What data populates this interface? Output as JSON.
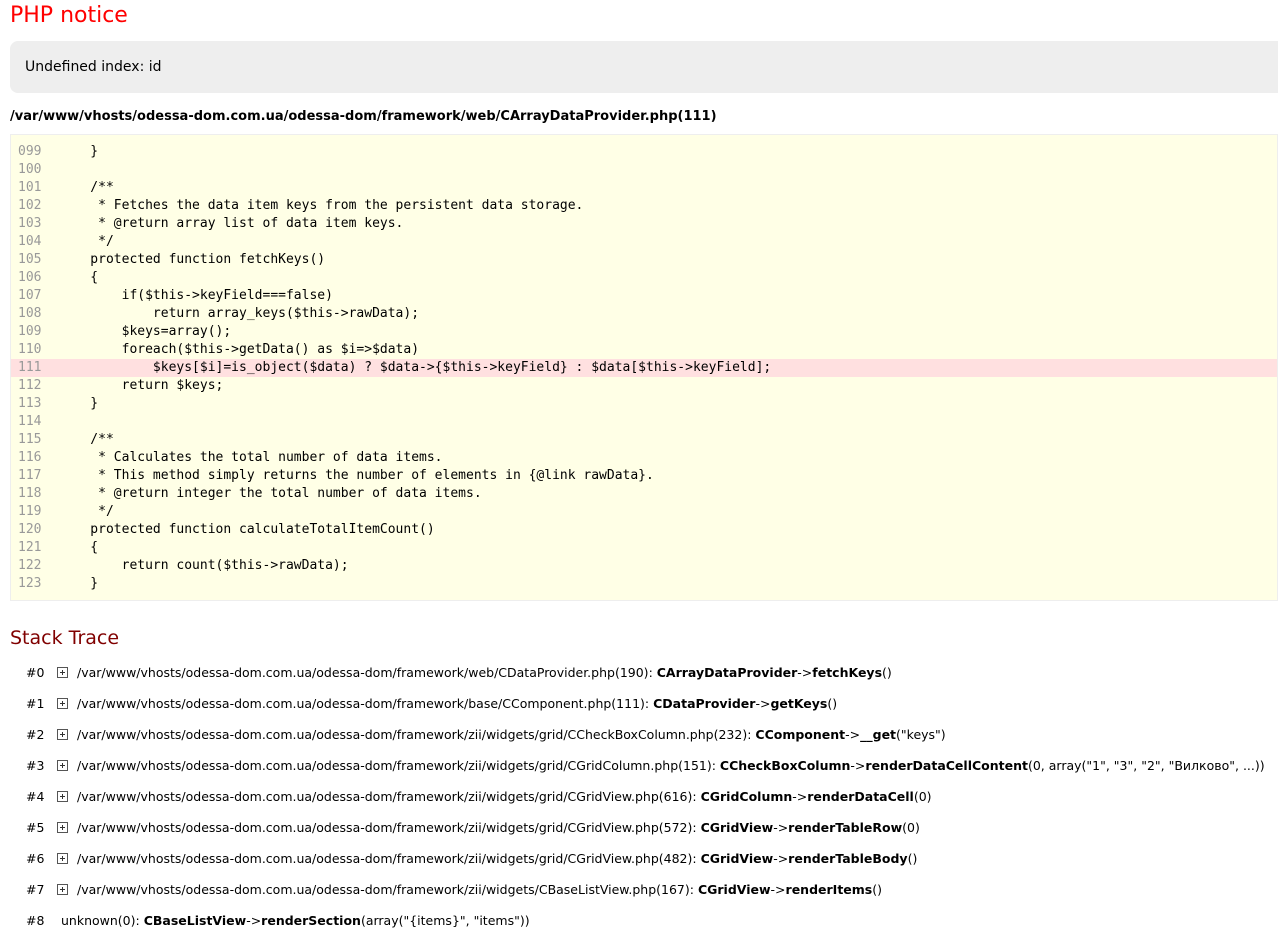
{
  "error": {
    "title": "PHP notice",
    "message": "Undefined index: id",
    "file": "/var/www/vhosts/odessa-dom.com.ua/odessa-dom/framework/web/CArrayDataProvider.php(111)"
  },
  "source": {
    "error_line": "111",
    "lines": [
      {
        "num": "099",
        "text": "    }"
      },
      {
        "num": "100",
        "text": ""
      },
      {
        "num": "101",
        "text": "    /**"
      },
      {
        "num": "102",
        "text": "     * Fetches the data item keys from the persistent data storage."
      },
      {
        "num": "103",
        "text": "     * @return array list of data item keys."
      },
      {
        "num": "104",
        "text": "     */"
      },
      {
        "num": "105",
        "text": "    protected function fetchKeys()"
      },
      {
        "num": "106",
        "text": "    {"
      },
      {
        "num": "107",
        "text": "        if($this->keyField===false)"
      },
      {
        "num": "108",
        "text": "            return array_keys($this->rawData);"
      },
      {
        "num": "109",
        "text": "        $keys=array();"
      },
      {
        "num": "110",
        "text": "        foreach($this->getData() as $i=>$data)"
      },
      {
        "num": "111",
        "text": "            $keys[$i]=is_object($data) ? $data->{$this->keyField} : $data[$this->keyField];"
      },
      {
        "num": "112",
        "text": "        return $keys;"
      },
      {
        "num": "113",
        "text": "    }"
      },
      {
        "num": "114",
        "text": ""
      },
      {
        "num": "115",
        "text": "    /**"
      },
      {
        "num": "116",
        "text": "     * Calculates the total number of data items."
      },
      {
        "num": "117",
        "text": "     * This method simply returns the number of elements in {@link rawData}."
      },
      {
        "num": "118",
        "text": "     * @return integer the total number of data items."
      },
      {
        "num": "119",
        "text": "     */"
      },
      {
        "num": "120",
        "text": "    protected function calculateTotalItemCount()"
      },
      {
        "num": "121",
        "text": "    {"
      },
      {
        "num": "122",
        "text": "        return count($this->rawData);"
      },
      {
        "num": "123",
        "text": "    }"
      }
    ]
  },
  "stack": {
    "heading": "Stack Trace",
    "traces": [
      {
        "num": "#0",
        "expandable": true,
        "file": "/var/www/vhosts/odessa-dom.com.ua/odessa-dom/framework/web/CDataProvider.php(190): ",
        "class": "CArrayDataProvider",
        "arrow": "->",
        "method": "fetchKeys",
        "args": "()"
      },
      {
        "num": "#1",
        "expandable": true,
        "file": "/var/www/vhosts/odessa-dom.com.ua/odessa-dom/framework/base/CComponent.php(111): ",
        "class": "CDataProvider",
        "arrow": "->",
        "method": "getKeys",
        "args": "()"
      },
      {
        "num": "#2",
        "expandable": true,
        "file": "/var/www/vhosts/odessa-dom.com.ua/odessa-dom/framework/zii/widgets/grid/CCheckBoxColumn.php(232): ",
        "class": "CComponent",
        "arrow": "->",
        "method": "__get",
        "args": "(\"keys\")"
      },
      {
        "num": "#3",
        "expandable": true,
        "file": "/var/www/vhosts/odessa-dom.com.ua/odessa-dom/framework/zii/widgets/grid/CGridColumn.php(151): ",
        "class": "CCheckBoxColumn",
        "arrow": "->",
        "method": "renderDataCellContent",
        "args": "(0, array(\"1\", \"3\", \"2\", \"Вилково\", ...))"
      },
      {
        "num": "#4",
        "expandable": true,
        "file": "/var/www/vhosts/odessa-dom.com.ua/odessa-dom/framework/zii/widgets/grid/CGridView.php(616): ",
        "class": "CGridColumn",
        "arrow": "->",
        "method": "renderDataCell",
        "args": "(0)"
      },
      {
        "num": "#5",
        "expandable": true,
        "file": "/var/www/vhosts/odessa-dom.com.ua/odessa-dom/framework/zii/widgets/grid/CGridView.php(572): ",
        "class": "CGridView",
        "arrow": "->",
        "method": "renderTableRow",
        "args": "(0)"
      },
      {
        "num": "#6",
        "expandable": true,
        "file": "/var/www/vhosts/odessa-dom.com.ua/odessa-dom/framework/zii/widgets/grid/CGridView.php(482): ",
        "class": "CGridView",
        "arrow": "->",
        "method": "renderTableBody",
        "args": "()"
      },
      {
        "num": "#7",
        "expandable": true,
        "file": "/var/www/vhosts/odessa-dom.com.ua/odessa-dom/framework/zii/widgets/CBaseListView.php(167): ",
        "class": "CGridView",
        "arrow": "->",
        "method": "renderItems",
        "args": "()"
      },
      {
        "num": "#8",
        "expandable": false,
        "file": "unknown(0): ",
        "class": "CBaseListView",
        "arrow": "->",
        "method": "renderSection",
        "args": "(array(\"{items}\", \"items\"))"
      }
    ]
  }
}
